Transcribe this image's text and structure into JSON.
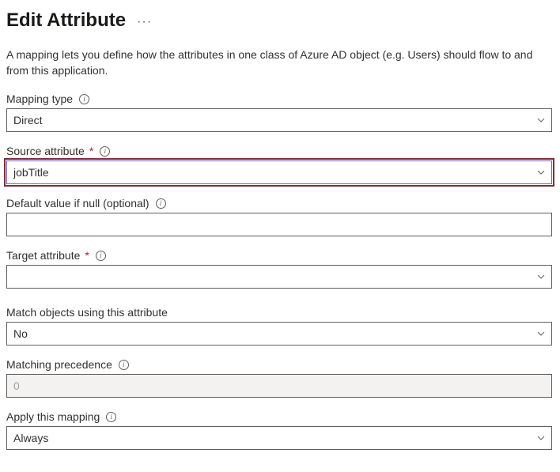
{
  "header": {
    "title": "Edit Attribute"
  },
  "description": "A mapping lets you define how the attributes in one class of Azure AD object (e.g. Users) should flow to and from this application.",
  "fields": {
    "mappingType": {
      "label": "Mapping type",
      "value": "Direct",
      "required": false
    },
    "sourceAttribute": {
      "label": "Source attribute",
      "value": "jobTitle",
      "required": true
    },
    "defaultValue": {
      "label": "Default value if null (optional)",
      "value": "",
      "required": false
    },
    "targetAttribute": {
      "label": "Target attribute",
      "value": "",
      "required": true
    },
    "matchObjects": {
      "label": "Match objects using this attribute",
      "value": "No",
      "required": false
    },
    "matchingPrecedence": {
      "label": "Matching precedence",
      "value": "0",
      "required": false
    },
    "applyMapping": {
      "label": "Apply this mapping",
      "value": "Always",
      "required": false
    }
  }
}
